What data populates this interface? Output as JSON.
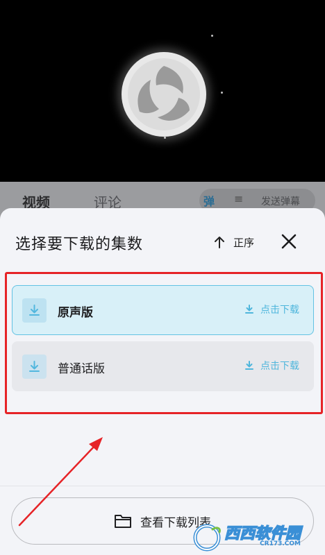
{
  "video": {
    "logo_icon": "three-blade-spiral-logo"
  },
  "tabs": [
    {
      "label": "视频",
      "active": true
    },
    {
      "label": "评论",
      "active": false
    }
  ],
  "danmu": {
    "toggle_label": "弹",
    "style_label": "≡",
    "send_label": "发送弹幕"
  },
  "sheet": {
    "title": "选择要下载的集数",
    "sort_label": "正序",
    "sort_icon": "arrow-up-icon",
    "close_icon": "close-icon"
  },
  "options": [
    {
      "label": "原声版",
      "action_label": "点击下载",
      "icon": "download-icon",
      "selected": true
    },
    {
      "label": "普通话版",
      "action_label": "点击下载",
      "icon": "download-icon",
      "selected": false
    }
  ],
  "footer": {
    "list_button_label": "查看下载列表",
    "list_button_icon": "folder-icon"
  },
  "watermark": {
    "text": "西西软件园",
    "url": "CR173.COM"
  },
  "colors": {
    "accent": "#4fb6dc",
    "selected_bg": "#d8f0f8",
    "annotation_red": "#e62327"
  }
}
